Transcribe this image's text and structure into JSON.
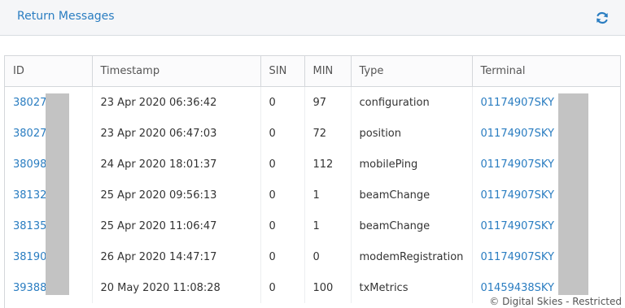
{
  "header": {
    "title": "Return Messages",
    "refresh_icon": "refresh-icon",
    "accent": "#2a7dc1"
  },
  "table": {
    "columns": [
      "ID",
      "Timestamp",
      "SIN",
      "MIN",
      "Type",
      "Terminal"
    ],
    "rows": [
      {
        "id": "38027",
        "timestamp": "23 Apr 2020 06:36:42",
        "sin": "0",
        "min": "97",
        "type": "configuration",
        "terminal": "01174907SKY"
      },
      {
        "id": "38027",
        "timestamp": "23 Apr 2020 06:47:03",
        "sin": "0",
        "min": "72",
        "type": "position",
        "terminal": "01174907SKY"
      },
      {
        "id": "38098",
        "timestamp": "24 Apr 2020 18:01:37",
        "sin": "0",
        "min": "112",
        "type": "mobilePing",
        "terminal": "01174907SKY"
      },
      {
        "id": "38132",
        "timestamp": "25 Apr 2020 09:56:13",
        "sin": "0",
        "min": "1",
        "type": "beamChange",
        "terminal": "01174907SKY"
      },
      {
        "id": "38135",
        "timestamp": "25 Apr 2020 11:06:47",
        "sin": "0",
        "min": "1",
        "type": "beamChange",
        "terminal": "01174907SKY"
      },
      {
        "id": "38190",
        "timestamp": "26 Apr 2020 14:47:17",
        "sin": "0",
        "min": "0",
        "type": "modemRegistration",
        "terminal": "01174907SKY"
      },
      {
        "id": "39388",
        "timestamp": "20 May 2020 11:08:28",
        "sin": "0",
        "min": "100",
        "type": "txMetrics",
        "terminal": "01459438SKY"
      }
    ]
  },
  "watermark": "© Digital Skies - Restricted"
}
